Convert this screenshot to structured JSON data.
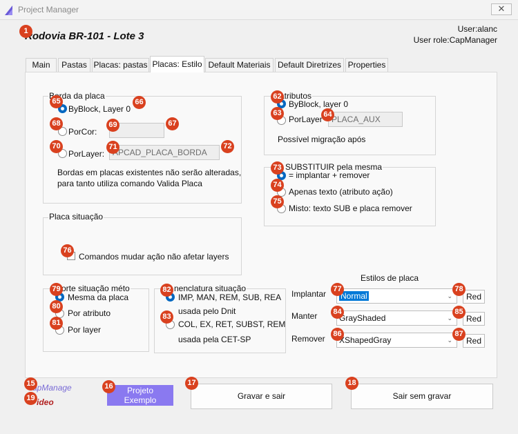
{
  "window": {
    "title": "Project Manager",
    "close_glyph": "✕"
  },
  "header": {
    "project_title": "Rodovia BR-101 - Lote 3",
    "user": "User:alanc",
    "role": "User role:CapManager"
  },
  "tabs": [
    "Main",
    "Pastas",
    "Placas: pastas",
    "Placas: Estilo",
    "Default Materiais",
    "Default Diretrizes",
    "Properties"
  ],
  "active_tab": "Placas: Estilo",
  "borda": {
    "legend": "Borda da placa",
    "opt_byblock": "ByBlock, Layer 0",
    "opt_porcor": "PorCor:",
    "color_value": "",
    "opt_porlayer": "PorLayer:",
    "layer_value": "APCAD_PLACA_BORDA",
    "note_line1": "Bordas em placas existentes não serão alteradas,",
    "note_line2": "para tanto utiliza comando Valida Placa"
  },
  "atributos": {
    "legend": "atributos",
    "opt_byblock": "ByBlock, layer 0",
    "opt_porlayer": "PorLayer",
    "layer_value": "PLACA_AUX",
    "note": "Possível migração após"
  },
  "substituir": {
    "legend": "a SUBSTITUIR pela mesma",
    "opt1": "= implantar + remover",
    "opt2": "Apenas texto (atributo ação)",
    "opt3": "Misto: texto SUB e placa remover"
  },
  "situacao": {
    "legend": "Placa situação",
    "checkbox": "Comandos mudar ação não afetar layers"
  },
  "suporte": {
    "legend": "orte situação méto",
    "opt1": "Mesma da placa",
    "opt2": "Por atributo",
    "opt3": "Por layer"
  },
  "nomenclatura": {
    "legend": "nenclatura situação",
    "opt1_line1": "IMP, MAN, REM, SUB, REA",
    "opt1_line2": "usada pelo Dnit",
    "opt2_line1": "COL, EX, RET, SUBST, REM",
    "opt2_line2": "usada pela CET-SP"
  },
  "estilos": {
    "title": "Estilos de placa",
    "rows": [
      {
        "label": "Implantar",
        "value": "Normal",
        "button": "Red"
      },
      {
        "label": "Manter",
        "value": "GrayShaded",
        "button": "Red"
      },
      {
        "label": "Remover",
        "value": "XShapedGray",
        "button": "Red"
      }
    ]
  },
  "footer": {
    "brand1": "apManage",
    "brand2": "ideo",
    "projeto_button": "Projeto\nExemplo",
    "save_button": "Gravar e sair",
    "exit_button": "Sair sem gravar"
  },
  "badges": {
    "b1": "1",
    "b15": "15",
    "b16": "16",
    "b17": "17",
    "b18": "18",
    "b19": "19",
    "b62": "62",
    "b63": "63",
    "b64": "64",
    "b65": "65",
    "b66": "66",
    "b67": "67",
    "b68": "68",
    "b69": "69",
    "b70": "70",
    "b71": "71",
    "b72": "72",
    "b73": "73",
    "b74": "74",
    "b75": "75",
    "b76": "76",
    "b77": "77",
    "b78": "78",
    "b79": "79",
    "b80": "80",
    "b81": "81",
    "b82": "82",
    "b83": "83",
    "b84": "84",
    "b85": "85",
    "b86": "86",
    "b87": "87"
  },
  "colors": {
    "accent": "#0067c0",
    "badge": "#d9411f",
    "projeto_button": "#8a79f0",
    "brand_purple": "#7a6cd6",
    "brand_red": "#b22222"
  }
}
